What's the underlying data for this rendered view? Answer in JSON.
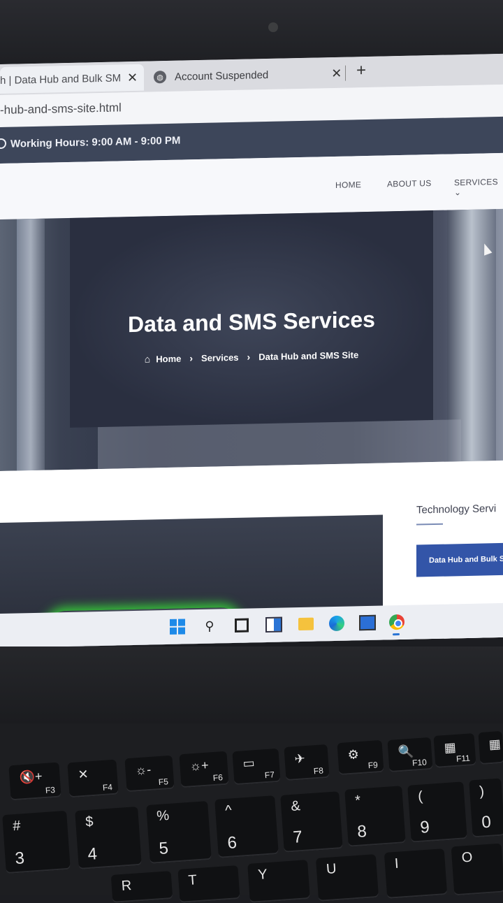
{
  "browser": {
    "tabs": [
      {
        "label": "h | Data Hub and Bulk SM",
        "close": "✕"
      },
      {
        "label": "Account Suspended",
        "close": "✕"
      }
    ],
    "new_tab": "+",
    "url": "-hub-and-sms-site.html"
  },
  "site": {
    "working_hours": "Working Hours: 9:00 AM - 9:00 PM",
    "nav": {
      "home": "HOME",
      "about": "ABOUT US",
      "services": "SERVICES ⌄"
    },
    "hero": {
      "title": "Data and SMS Services",
      "breadcrumb": {
        "home": "Home",
        "services": "Services",
        "current": "Data Hub and SMS Site",
        "separator": "›"
      }
    },
    "sidebar": {
      "title": "Technology Servi",
      "active_item": "Data Hub and Bulk S"
    }
  },
  "keyboard": {
    "fkeys": [
      {
        "icon": "🔇+",
        "label": "F3"
      },
      {
        "icon": "✕",
        "label": "F4"
      },
      {
        "icon": "☼-",
        "label": "F5"
      },
      {
        "icon": "☼+",
        "label": "F6"
      },
      {
        "icon": "▭",
        "label": "F7"
      },
      {
        "icon": "✈",
        "label": "F8"
      },
      {
        "icon": "⚙",
        "label": "F9"
      },
      {
        "icon": "🔍",
        "label": "F10"
      },
      {
        "icon": "▦",
        "label": "F11"
      },
      {
        "icon": "▦",
        "label": ""
      }
    ],
    "number_keys": [
      {
        "top": "#",
        "bottom": "3"
      },
      {
        "top": "$",
        "bottom": "4"
      },
      {
        "top": "%",
        "bottom": "5"
      },
      {
        "top": "^",
        "bottom": "6"
      },
      {
        "top": "&",
        "bottom": "7"
      },
      {
        "top": "*",
        "bottom": "8"
      },
      {
        "top": "(",
        "bottom": "9"
      },
      {
        "top": ")",
        "bottom": "0"
      }
    ],
    "letter_keys": [
      "R",
      "T",
      "Y",
      "U",
      "I",
      "O"
    ]
  }
}
